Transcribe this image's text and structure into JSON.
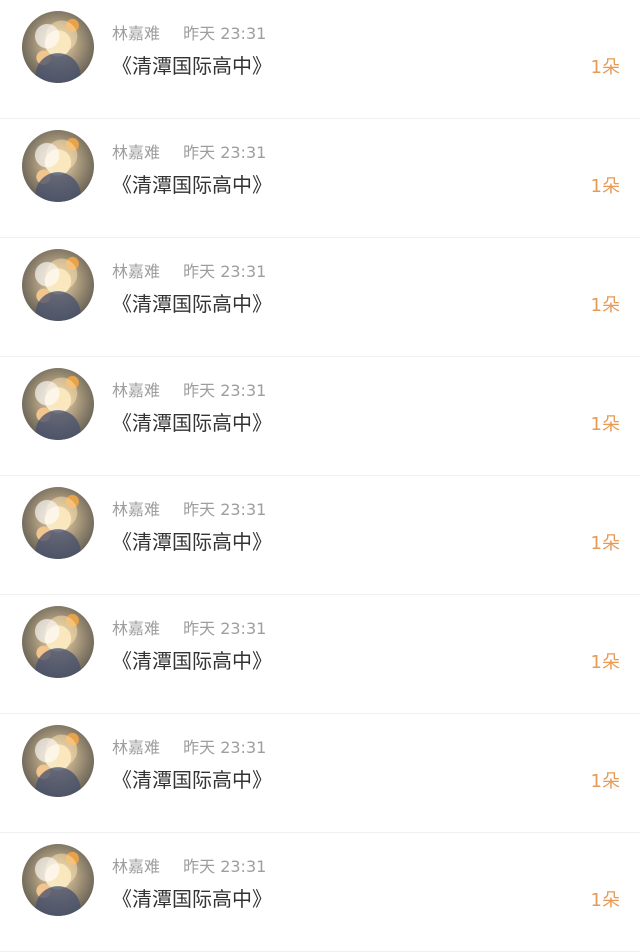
{
  "comments": [
    {
      "author": "林嘉难",
      "time": "昨天 23:31",
      "text": "《清潭国际高中》",
      "count": "1朵"
    },
    {
      "author": "林嘉难",
      "time": "昨天 23:31",
      "text": "《清潭国际高中》",
      "count": "1朵"
    },
    {
      "author": "林嘉难",
      "time": "昨天 23:31",
      "text": "《清潭国际高中》",
      "count": "1朵"
    },
    {
      "author": "林嘉难",
      "time": "昨天 23:31",
      "text": "《清潭国际高中》",
      "count": "1朵"
    },
    {
      "author": "林嘉难",
      "time": "昨天 23:31",
      "text": "《清潭国际高中》",
      "count": "1朵"
    },
    {
      "author": "林嘉难",
      "time": "昨天 23:31",
      "text": "《清潭国际高中》",
      "count": "1朵"
    },
    {
      "author": "林嘉难",
      "time": "昨天 23:31",
      "text": "《清潭国际高中》",
      "count": "1朵"
    },
    {
      "author": "林嘉难",
      "time": "昨天 23:31",
      "text": "《清潭国际高中》",
      "count": "1朵"
    }
  ],
  "colors": {
    "meta": "#9e9e9e",
    "content": "#333333",
    "count": "#e79a56",
    "divider": "#f0f0f0"
  }
}
